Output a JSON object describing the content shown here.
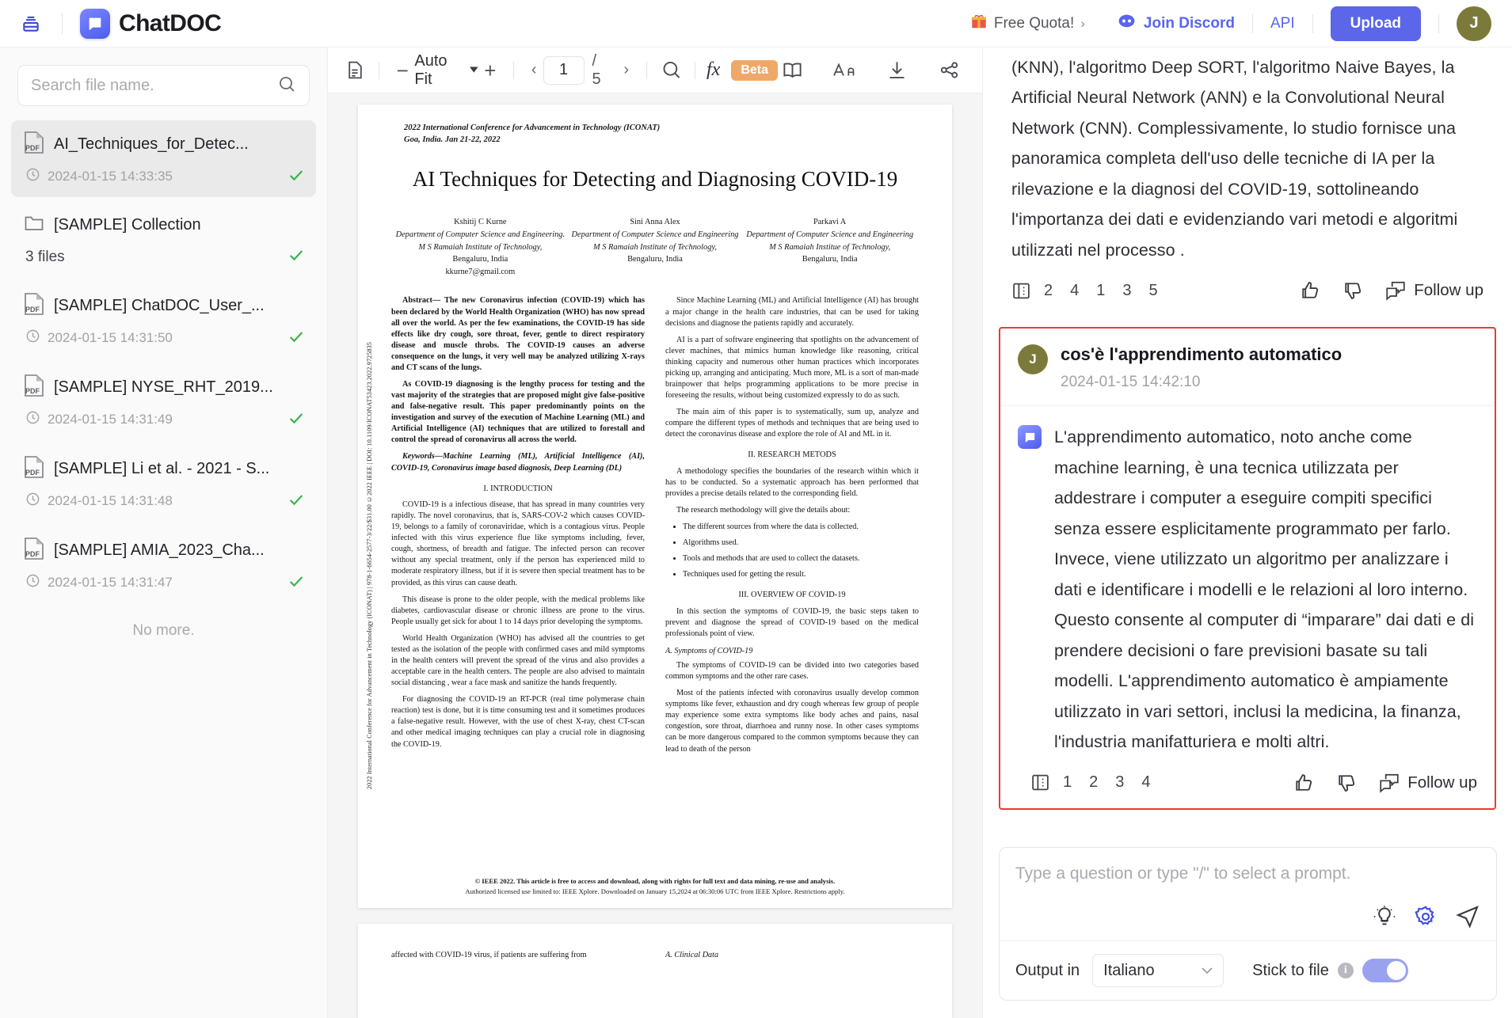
{
  "topbar": {
    "logo_text": "ChatDOC",
    "quota_label": "Free Quota!",
    "discord_label": "Join Discord",
    "api_label": "API",
    "upload_label": "Upload",
    "avatar_initial": "J"
  },
  "sidebar": {
    "search_placeholder": "Search file name.",
    "no_more": "No more.",
    "items": [
      {
        "type": "pdf",
        "name": "AI_Techniques_for_Detec...",
        "time": "2024-01-15 14:33:35",
        "active": true
      },
      {
        "type": "folder",
        "name": "[SAMPLE] Collection",
        "count": "3 files"
      },
      {
        "type": "pdf",
        "name": "[SAMPLE] ChatDOC_User_...",
        "time": "2024-01-15 14:31:50"
      },
      {
        "type": "pdf",
        "name": "[SAMPLE] NYSE_RHT_2019...",
        "time": "2024-01-15 14:31:49"
      },
      {
        "type": "pdf",
        "name": "[SAMPLE] Li et al. - 2021 - S...",
        "time": "2024-01-15 14:31:48"
      },
      {
        "type": "pdf",
        "name": "[SAMPLE] AMIA_2023_Cha...",
        "time": "2024-01-15 14:31:47"
      }
    ]
  },
  "pdf_toolbar": {
    "zoom_label": "Auto Fit",
    "minus": "−",
    "plus": "+",
    "prev": "‹",
    "next": "›",
    "current_page": "1",
    "total_pages": "/ 5",
    "fx_label": "fx",
    "beta_label": "Beta"
  },
  "document": {
    "conference_line1": "2022 International Conference for Advancement in Technology (ICONAT)",
    "conference_line2": "Goa, India. Jan 21-22, 2022",
    "title": "AI Techniques for Detecting and Diagnosing COVID-19",
    "side_stamp": "2022 International Conference for Advancement in Technology (ICONAT) | 978-1-6654-2577-3/22/$31.00 ©2022 IEEE | DOI: 10.1109/ICONAT53423.2022.9725835",
    "authors": [
      {
        "name": "Kshitij C Kurne",
        "dept": "Department of Computer Science and Engineering.",
        "inst": "M S Ramaiah Institute of Technology,",
        "city": "Bengaluru, India",
        "email": "kkurne7@gmail.com"
      },
      {
        "name": "Sini Anna Alex",
        "dept": "Department of Computer Science and Engineering",
        "inst": "M S Ramaiah Institute of Technology,",
        "city": "Bengaluru, India",
        "email": ""
      },
      {
        "name": "Parkavi A",
        "dept": "Department of Computer Science and Engineering",
        "inst": "M S Ramaiah Institue of Technology,",
        "city": "Bengaluru, India",
        "email": ""
      }
    ],
    "left_col": {
      "abstract": "Abstract— The new Coronavirus infection (COVID-19) which has been declared by the World Health Organization (WHO) has now spread all over the world. As per the few examinations, the COVID-19 has side effects like dry cough, sore throat, fever, gentle to direct respiratory disease and muscle throbs. The COVID-19 causes an adverse consequence on the lungs, it very well may be analyzed utilizing X-rays and CT scans of the lungs.",
      "abstract2": "As COVID-19 diagnosing is the lengthy process for testing and the vast majority of the strategies that are proposed might give false-positive and false-negative result. This paper predominantly points on the investigation and survey of the execution of Machine Learning (ML) and Artificial Intelligence (AI) techniques that are utilized to forestall and control the spread of coronavirus all across the world.",
      "keywords": "Keywords—Machine Learning (ML), Artificial Intelligence (AI), COVID-19, Coronavirus image based diagnosis, Deep Learning (DL)",
      "heading1": "I.      INTRODUCTION",
      "p1": "COVID-19 is a infectious disease, that has spread in many countries very rapidly. The novel coronavirus, that is, SARS-COV-2 which causes COVID-19, belongs to a family of coronaviridae, which is a contagious virus. People infected with this virus experience flue like symptoms including, fever, cough, shortness, of breadth and fatigue. The infected person can recover without any special treatment, only if the person has experienced mild to moderate respiratory illness, but if it is severe then special treatment has to be provided, as this virus can cause death.",
      "p2": "This disease is prone to the older people, with the medical problems like diabetes, cardiovascular disease or chronic illness are prone to the virus. People usually get sick for about 1 to 14 days prior developing the symptoms.",
      "p3": "World Health Organization (WHO) has advised all the countries to get tested as the isolation of the people with confirmed cases and mild symptoms in the health centers will prevent the spread of the virus and also provides a acceptable care in the health centers. The people are also advised to maintain social distancing , wear a face mask and sanitize the hands frequently.",
      "p4": "For diagnosing the COVID-19 an RT-PCR (real time polymerase chain reaction) test is done, but it is time consuming test and it sometimes produces a false-negative result. However, with the use of chest X-ray, chest CT-scan and other medical imaging techniques can play a crucial role in diagnosing the COVID-19."
    },
    "right_col": {
      "p1": "Since Machine Learning (ML) and Artificial Intelligence (AI) has brought a major change in the health care industries, that can be used for taking decisions and diagnose the patients rapidly and accurately.",
      "p2": "AI is a part of software engineering that spotlights on the advancement of clever machines, that mimics human knowledge like reasoning, critical thinking capacity and numerous other human practices which incorporates picking up, arranging and anticipating. Much more, ML is a sort of man-made brainpower that helps programming applications to be more precise in foreseeing the results, without being customized expressly to do as such.",
      "p3": "The main aim of this paper is to systematically, sum up, analyze and compare the different types of methods and techniques that are being used to detect the coronavirus disease and explore the role of AI and ML in it.",
      "heading2": "II.      RESEARCH METODS",
      "p4": "A methodology specifies the boundaries of the research within which it has to be conducted. So a systematic approach has been performed that provides a precise details related to the corresponding field.",
      "p5": "The research methodology will give the details about:",
      "bullets": [
        "The different sources from where the data is collected.",
        "Algorithms used.",
        "Tools and methods that are used to collect the datasets.",
        "Techniques used for getting the result."
      ],
      "heading3": "III.      OVERVIEW OF COVID-19",
      "p6": "In this section the symptoms of COVID-19, the basic steps taken to prevent and diagnose the spread of COVID-19 based on the medical professionals point of view.",
      "sec_a": "A.    Symptoms of COVID-19",
      "p7": "The symptoms of COVID-19 can be divided into two categories based common symptoms and the other rare cases.",
      "p8": "Most of the patients infected with coronavirus usually develop common symptoms like fever, exhaustion and dry cough whereas few group of people may experience some extra symptoms like body aches and pains, nasal congestion, sore throat, diarrhoea and runny nose. In other cases symptoms can be more dangerous compared to the common symptoms because they can lead to death of the person"
    },
    "footer_line1": "© IEEE 2022. This article is free to access and download, along with rights for full text and data mining, re-use and analysis.",
    "footer_line2": "Authorized licensed use limited to: IEEE Xplore. Downloaded on January 15,2024 at 06:30:06 UTC from IEEE Xplore.  Restrictions apply.",
    "page2_left": "affected with COVID-19 virus, if patients are suffering from",
    "page2_right": "A.    Clinical Data"
  },
  "chat": {
    "previous_answer": "(KNN), l'algoritmo Deep SORT, l'algoritmo Naive Bayes, la Artificial Neural Network (ANN) e la Convolutional Neural Network (CNN). Complessivamente, lo studio fornisce una panoramica completa dell'uso delle tecniche di IA per la rilevazione e la diagnosi del COVID-19, sottolineando l'importanza dei dati e evidenziando vari metodi e algoritmi utilizzati nel processo .",
    "previous_citations": [
      "2",
      "4",
      "1",
      "3",
      "5"
    ],
    "followup_label": "Follow up",
    "question": {
      "avatar_initial": "J",
      "text": "cos'è l'apprendimento automatico",
      "time": "2024-01-15 14:42:10"
    },
    "answer": {
      "text": "L'apprendimento automatico, noto anche come machine learning, è una tecnica utilizzata per addestrare i computer a eseguire compiti specifici senza essere esplicitamente programmato per farlo. Invece, viene utilizzato un algoritmo per analizzare i dati e identificare i modelli e le relazioni al loro interno. Questo consente al computer di “imparare” dai dati e di prendere decisioni o fare previsioni basate su tali modelli. L'apprendimento automatico è ampiamente utilizzato in vari settori, inclusi la medicina, la finanza, l'industria manifatturiera e molti altri.",
      "citations": [
        "1",
        "2",
        "3",
        "4"
      ]
    }
  },
  "composer": {
    "placeholder": "Type a question or type \"/\" to select a prompt.",
    "output_label": "Output in",
    "language": "Italiano",
    "stick_label": "Stick to file",
    "info_glyph": "i",
    "chevron": "⌄"
  },
  "colors": {
    "accent": "#5b66e8",
    "highlight_border": "#e83b33",
    "avatar_bg": "#7b7a3a",
    "beta_bg": "#f0a868"
  }
}
